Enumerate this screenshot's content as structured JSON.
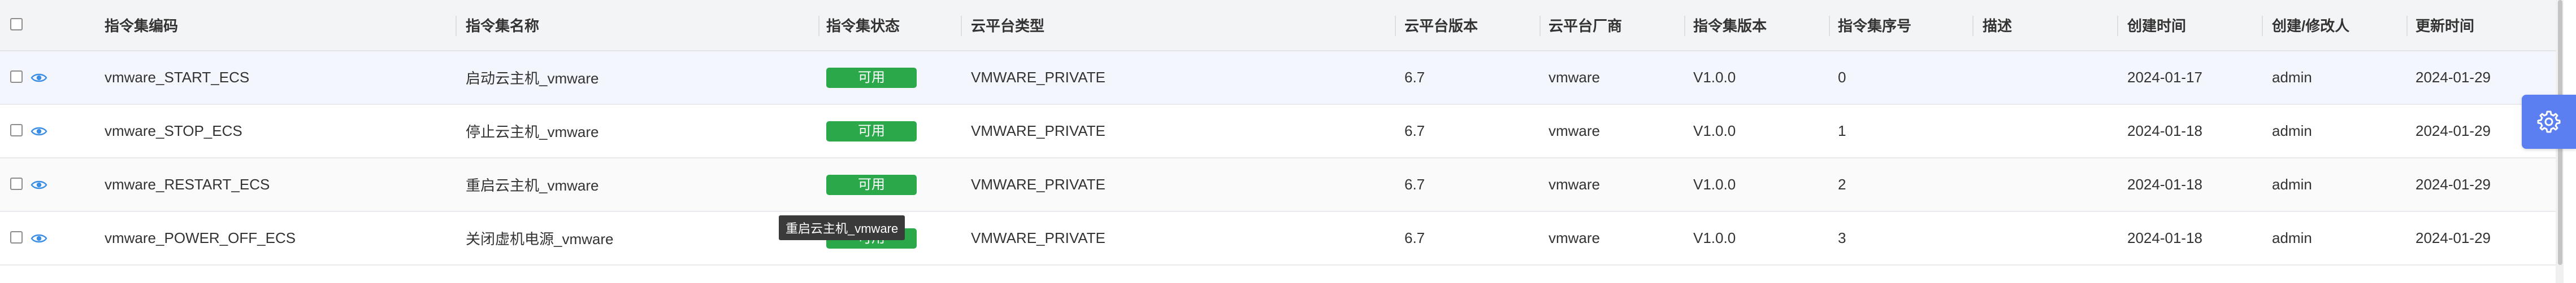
{
  "table": {
    "headers": {
      "code": "指令集编码",
      "name": "指令集名称",
      "status": "指令集状态",
      "platform_type": "云平台类型",
      "platform_version": "云平台版本",
      "vendor": "云平台厂商",
      "set_version": "指令集版本",
      "seq": "指令集序号",
      "desc": "描述",
      "created": "创建时间",
      "creator": "创建/修改人",
      "updated": "更新时间"
    },
    "rows": [
      {
        "code": "vmware_START_ECS",
        "name": "启动云主机_vmware",
        "status": "可用",
        "platform_type": "VMWARE_PRIVATE",
        "platform_version": "6.7",
        "vendor": "vmware",
        "set_version": "V1.0.0",
        "seq": "0",
        "desc": "",
        "created": "2024-01-17",
        "creator": "admin",
        "updated": "2024-01-29"
      },
      {
        "code": "vmware_STOP_ECS",
        "name": "停止云主机_vmware",
        "status": "可用",
        "platform_type": "VMWARE_PRIVATE",
        "platform_version": "6.7",
        "vendor": "vmware",
        "set_version": "V1.0.0",
        "seq": "1",
        "desc": "",
        "created": "2024-01-18",
        "creator": "admin",
        "updated": "2024-01-29"
      },
      {
        "code": "vmware_RESTART_ECS",
        "name": "重启云主机_vmware",
        "status": "可用",
        "platform_type": "VMWARE_PRIVATE",
        "platform_version": "6.7",
        "vendor": "vmware",
        "set_version": "V1.0.0",
        "seq": "2",
        "desc": "",
        "created": "2024-01-18",
        "creator": "admin",
        "updated": "2024-01-29"
      },
      {
        "code": "vmware_POWER_OFF_ECS",
        "name": "关闭虚机电源_vmware",
        "status": "可用",
        "platform_type": "VMWARE_PRIVATE",
        "platform_version": "6.7",
        "vendor": "vmware",
        "set_version": "V1.0.0",
        "seq": "3",
        "desc": "",
        "created": "2024-01-18",
        "creator": "admin",
        "updated": "2024-01-29"
      }
    ]
  },
  "tooltip": {
    "text": "重启云主机_vmware"
  },
  "icons": {
    "view": "eye-icon",
    "settings": "gear-icon"
  },
  "colors": {
    "status_available": "#2aa84a",
    "settings_button": "#5b7ff0",
    "eye_icon": "#3a8ee6",
    "selected_row": "#f3f6fd"
  }
}
